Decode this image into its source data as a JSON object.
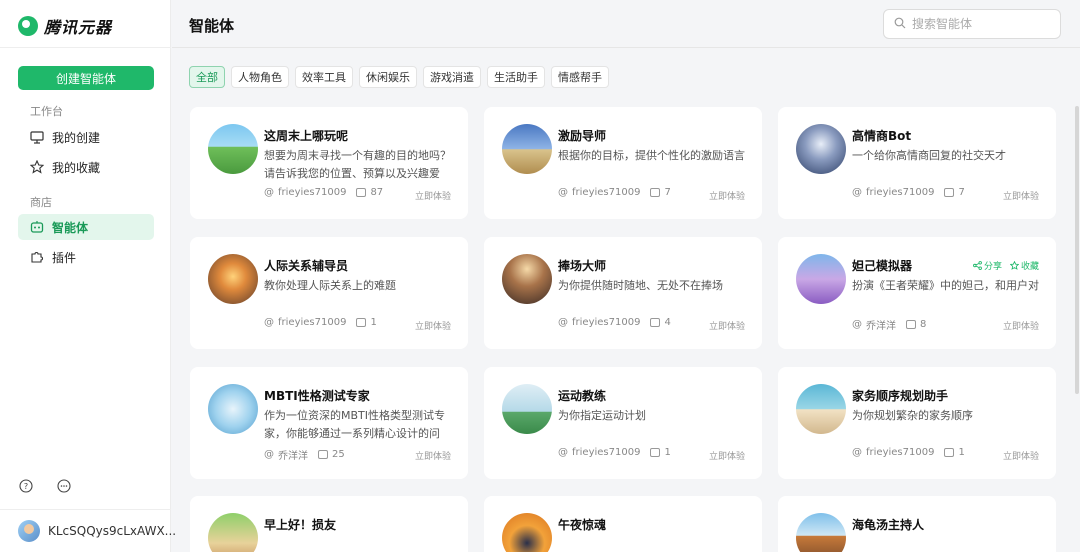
{
  "app": {
    "logo_text": "腾讯元器"
  },
  "sidebar": {
    "create_label": "创建智能体",
    "section_workbench": "工作台",
    "my_created": "我的创建",
    "my_favorites": "我的收藏",
    "section_store": "商店",
    "agents": "智能体",
    "plugins": "插件"
  },
  "user": {
    "name": "KLcSQQys9cLxAWX..."
  },
  "header": {
    "title": "智能体",
    "search_placeholder": "搜索智能体"
  },
  "tabs": [
    {
      "label": "全部"
    },
    {
      "label": "人物角色"
    },
    {
      "label": "效率工具"
    },
    {
      "label": "休闲娱乐"
    },
    {
      "label": "游戏消遣"
    },
    {
      "label": "生活助手"
    },
    {
      "label": "情感帮手"
    }
  ],
  "card_actions": {
    "share": "分享",
    "favorite": "收藏"
  },
  "cards": [
    {
      "title": "这周末上哪玩呢",
      "desc": "想要为周末寻找一个有趣的目的地吗？请告诉我您的位置、预算以及兴趣爱好，...",
      "author": "frieyies71009",
      "count": "87",
      "try": "立即体验"
    },
    {
      "title": "激励导师",
      "desc": "根据你的目标，提供个性化的激励语言",
      "author": "frieyies71009",
      "count": "7",
      "try": "立即体验"
    },
    {
      "title": "高情商Bot",
      "desc": "一个给你高情商回复的社交天才",
      "author": "frieyies71009",
      "count": "7",
      "try": "立即体验"
    },
    {
      "title": "人际关系辅导员",
      "desc": "教你处理人际关系上的难题",
      "author": "frieyies71009",
      "count": "1",
      "try": "立即体验"
    },
    {
      "title": "捧场大师",
      "desc": "为你提供随时随地、无处不在捧场",
      "author": "frieyies71009",
      "count": "4",
      "try": "立即体验"
    },
    {
      "title": "妲己模拟器",
      "desc": "扮演《王者荣耀》中的妲己，和用户对话",
      "author": "乔洋洋",
      "count": "8",
      "try": "立即体验"
    },
    {
      "title": "MBTI性格测试专家",
      "desc": "作为一位资深的MBTI性格类型测试专家，你能够通过一系列精心设计的问题...",
      "author": "乔洋洋",
      "count": "25",
      "try": "立即体验"
    },
    {
      "title": "运动教练",
      "desc": "为你指定运动计划",
      "author": "frieyies71009",
      "count": "1",
      "try": "立即体验"
    },
    {
      "title": "家务顺序规划助手",
      "desc": "为你规划繁杂的家务顺序",
      "author": "frieyies71009",
      "count": "1",
      "try": "立即体验"
    },
    {
      "title": "早上好！损友",
      "desc": "",
      "author": "",
      "count": "",
      "try": ""
    },
    {
      "title": "午夜惊魂",
      "desc": "",
      "author": "",
      "count": "",
      "try": ""
    },
    {
      "title": "海龟汤主持人",
      "desc": "",
      "author": "",
      "count": "",
      "try": ""
    }
  ]
}
